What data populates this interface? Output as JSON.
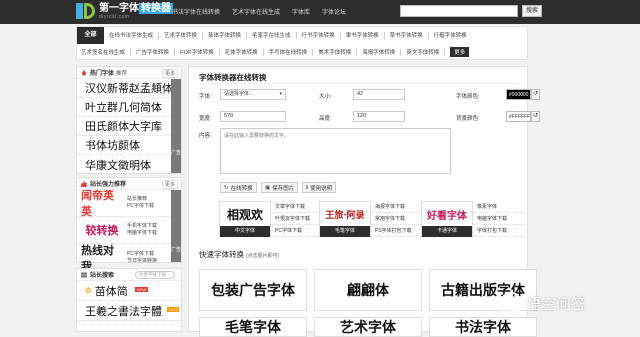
{
  "header": {
    "logo_title_a": "第一字体",
    "logo_title_b": "转换器",
    "logo_url": "diyiziti.com",
    "nav": [
      "书法字体在线转换",
      "艺术字体在线生成",
      "字体库",
      "字体论坛"
    ],
    "search_button": "搜索"
  },
  "categories": {
    "all": "全部",
    "row1": [
      "在线书法字体生成",
      "艺术字体转换",
      "篆体字体转换",
      "毛笔字在线生成",
      "行书字体转换",
      "隶书字体转换",
      "草书字体转换",
      "行楷字体转换"
    ],
    "row2": [
      "艺术签名在线生成",
      "广告字体转换",
      "POP字体转换",
      "花体字体转换",
      "手写体在线转换",
      "美术字体转换",
      "海报字体转换",
      "英文字体转换"
    ],
    "more": "更多"
  },
  "sidebar": {
    "hot": {
      "title": "热门字体",
      "subtitle": "推荐",
      "more": "更多",
      "items": [
        "汉仪新蒂赵孟頫体",
        "叶立群几何简体",
        "田氏颜体大字库",
        "书体坊颜体",
        "华康文徵明体"
      ],
      "tab_label": "广告"
    },
    "recommend": {
      "title": "站长强力推荐",
      "more": "更多",
      "items": [
        {
          "img": "闻帝英英",
          "color": "#e53935",
          "links": [
            "站长推荐",
            "PC字体下载"
          ]
        },
        {
          "img": "较转换",
          "color": "#c2185b",
          "links": [
            "手机字体下载",
            "电脑字体下载"
          ]
        },
        {
          "img": "热线对我",
          "color": "#222222",
          "links": [
            "PC字体下载",
            "节日字体转换"
          ]
        }
      ],
      "tab_label": "广告"
    },
    "station": {
      "title": "站长搜索",
      "search_placeholder": "免费字体下载",
      "items": [
        "苗体简",
        "王羲之書法字體"
      ],
      "badge_new": "NEW",
      "badge_hot": "HOT"
    }
  },
  "converter": {
    "title": "字体转换器在线转换",
    "font_label": "字体:",
    "font_value": "请选择字体...",
    "size_label": "大小:",
    "size_value": "42",
    "font_color_label": "字体颜色:",
    "font_color_value": "#000000",
    "width_label": "宽度:",
    "width_value": "570",
    "height_label": "高度:",
    "height_value": "120",
    "bg_color_label": "背景颜色:",
    "bg_color_value": "#FFFFFF",
    "content_label": "内容:",
    "content_placeholder": "请在此输入需要转换的文字。",
    "buttons": [
      "在线转换",
      "保存图片",
      "使用说明"
    ],
    "btn_icons": [
      "↻",
      "▣",
      "ℹ"
    ],
    "swatch_font": "#000000",
    "swatch_bg": "#FFFFFF"
  },
  "previews": [
    {
      "img": "相观欢",
      "label": "中文字体",
      "color": "#111111"
    },
    {
      "img": "王旅·阿录",
      "label": "毛笔字体",
      "color": "#b71c1c"
    },
    {
      "img": "好看字体",
      "label": "卡通字体",
      "color": "#c2185b"
    }
  ],
  "link_cols": [
    [
      "文章字体下载",
      "叶根友字体下载",
      "PC字体下载"
    ],
    [
      "海报字体下载",
      "常用字体下载",
      "PS字体打包下载"
    ],
    [
      "像素字体",
      "电脑字体下载",
      "字体打包下载"
    ]
  ],
  "quick": {
    "title": "快速字体转换",
    "hint": "(点击图片即可)",
    "cards": [
      "包装广告字体",
      "翩翩体",
      "古籍出版字体",
      "毛笔字体",
      "艺术字体",
      "书法字体"
    ]
  },
  "watermark": "悟空问答"
}
